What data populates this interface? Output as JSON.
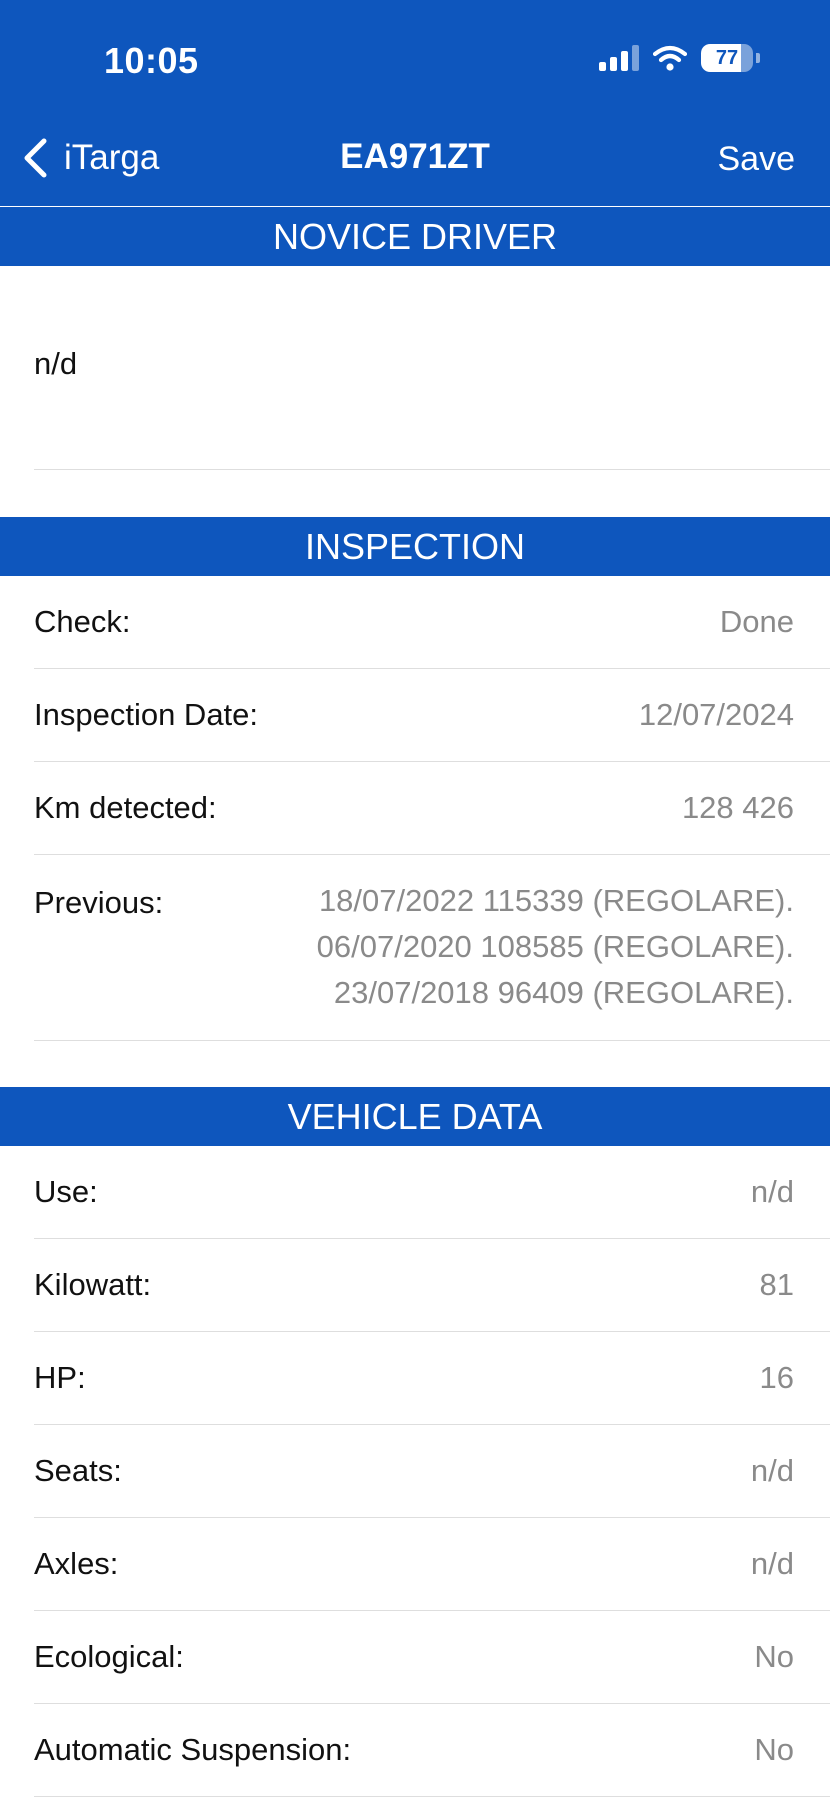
{
  "status_bar": {
    "time": "10:05",
    "battery_level": 77,
    "battery_label": "77",
    "signal_bars_active": 3
  },
  "nav": {
    "back_label": "iTarga",
    "title": "EA971ZT",
    "save_label": "Save"
  },
  "novice_driver": {
    "header": "NOVICE DRIVER",
    "value": "n/d"
  },
  "inspection": {
    "header": "INSPECTION",
    "check": {
      "label": "Check:",
      "value": "Done"
    },
    "date": {
      "label": "Inspection Date:",
      "value": "12/07/2024"
    },
    "km": {
      "label": "Km detected:",
      "value": "128 426"
    },
    "previous": {
      "label": "Previous:",
      "lines": [
        "18/07/2022 115339 (REGOLARE).",
        "06/07/2020 108585 (REGOLARE).",
        "23/07/2018 96409 (REGOLARE)."
      ]
    }
  },
  "vehicle_data": {
    "header": "VEHICLE DATA",
    "rows": [
      {
        "label": "Use:",
        "value": "n/d"
      },
      {
        "label": "Kilowatt:",
        "value": "81"
      },
      {
        "label": "HP:",
        "value": "16"
      },
      {
        "label": "Seats:",
        "value": "n/d"
      },
      {
        "label": "Axles:",
        "value": "n/d"
      },
      {
        "label": "Ecological:",
        "value": "No"
      },
      {
        "label": "Automatic Suspension:",
        "value": "No"
      }
    ]
  }
}
